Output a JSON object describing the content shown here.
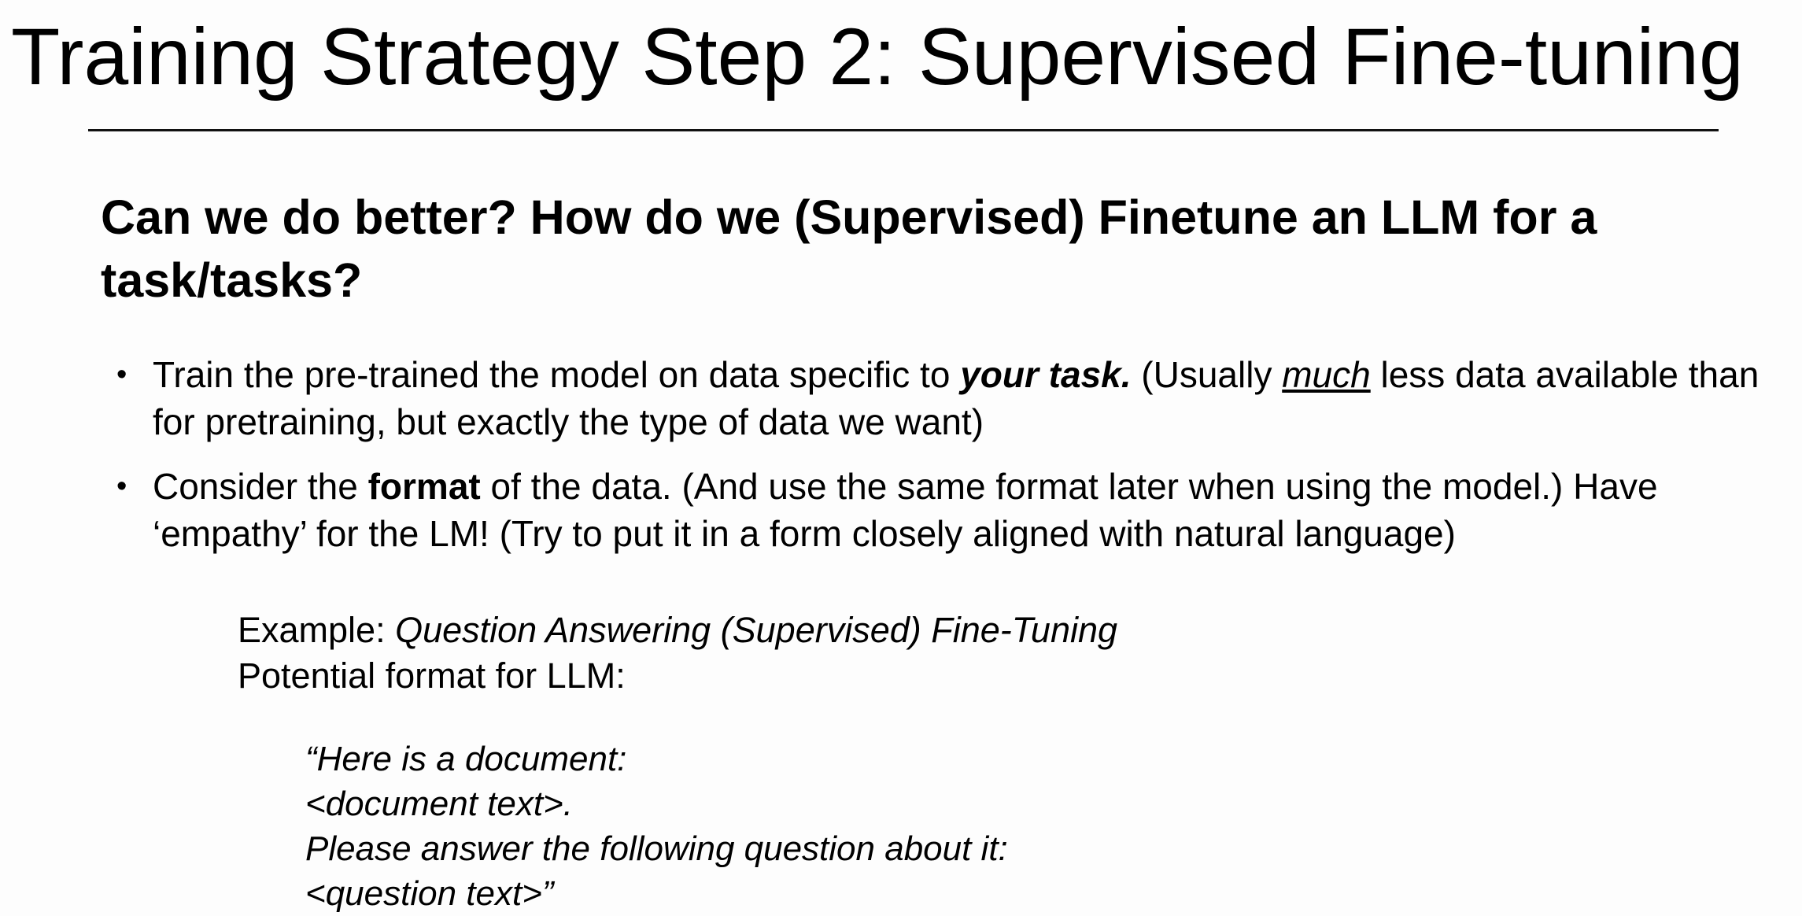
{
  "slide": {
    "title": "Training Strategy Step 2: Supervised Fine-tuning",
    "subheading": "Can we do better? How do we (Supervised) Finetune an LLM for a task/tasks?",
    "bullet_symbol": "•",
    "bullets": [
      {
        "part1": "Train the pre-trained the model on data specific to ",
        "emphasis": "your task.",
        "part2": " (Usually ",
        "underline": "much",
        "part3": " less data available than for pretraining, but exactly the type of data we want)"
      },
      {
        "part1": "Consider the ",
        "bold": "format",
        "part2": " of the data. (And use the same format later when using the model.) Have ‘empathy’ for the LM! (Try to put it in a form closely aligned with natural language)"
      }
    ],
    "example": {
      "label": "Example: ",
      "name": "Question Answering (Supervised) Fine-Tuning",
      "format_label": "Potential format for LLM:"
    },
    "prompt_lines": [
      "“Here is a document:",
      "<document text>.",
      "Please answer the following question about it:",
      "<question text>”"
    ]
  }
}
